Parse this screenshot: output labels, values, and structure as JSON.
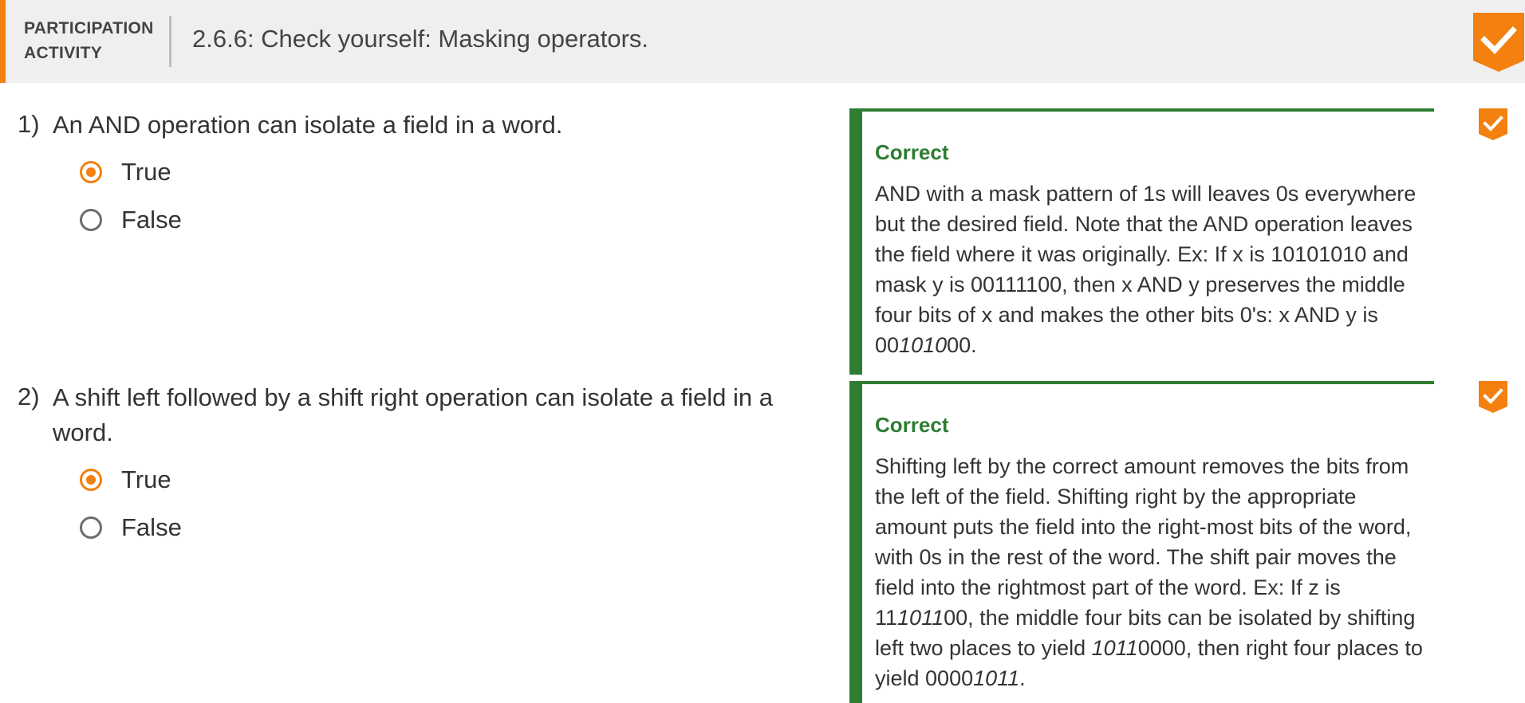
{
  "header": {
    "label_line1": "PARTICIPATION",
    "label_line2": "ACTIVITY",
    "title": "2.6.6: Check yourself: Masking operators.",
    "completion_icon": "check-badge-icon"
  },
  "colors": {
    "accent": "#f3800f",
    "correct": "#2e7d32",
    "header_bg": "#efefef"
  },
  "questions": [
    {
      "number": "1)",
      "text": "An AND operation can isolate a field in a word.",
      "options": [
        {
          "label": "True",
          "selected": true
        },
        {
          "label": "False",
          "selected": false
        }
      ],
      "feedback": {
        "title": "Correct",
        "segments": [
          "AND with a mask pattern of 1s will leaves 0s everywhere but the desired field. Note that the AND operation leaves the field where it was originally. Ex: If x is 10101010 and mask y is 00111100, then x AND y preserves the middle four bits of x and makes the other bits 0's: x AND y is 00",
          "1010",
          "00."
        ]
      },
      "status_icon": "check-badge-icon"
    },
    {
      "number": "2)",
      "text": "A shift left followed by a shift right operation can isolate a field in a word.",
      "options": [
        {
          "label": "True",
          "selected": true
        },
        {
          "label": "False",
          "selected": false
        }
      ],
      "feedback": {
        "title": "Correct",
        "segments": [
          "Shifting left by the correct amount removes the bits from the left of the field. Shifting right by the appropriate amount puts the field into the right-most bits of the word, with 0s in the rest of the word. The shift pair moves the field into the rightmost part of the word. Ex: If z is 11",
          "1011",
          "00, the middle four bits can be isolated by shifting left two places to yield ",
          "1011",
          "0000, then right four places to yield 0000",
          "1011",
          "."
        ]
      },
      "status_icon": "check-badge-icon"
    }
  ]
}
